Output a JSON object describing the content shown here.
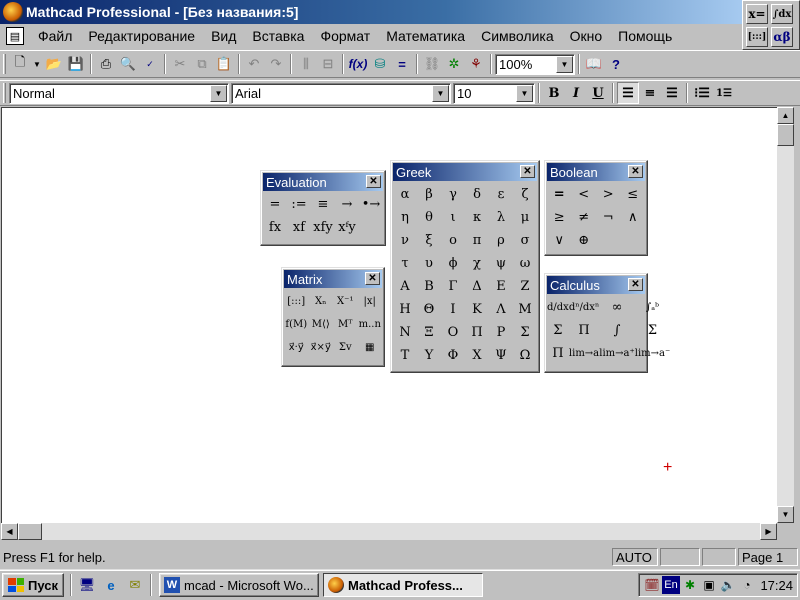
{
  "window": {
    "title": "Mathcad Professional - [Без названия:5]"
  },
  "math_palette": {
    "items": [
      "x=",
      "∫dx",
      "[:::]",
      "αβ"
    ]
  },
  "menu": {
    "items": [
      "Файл",
      "Редактирование",
      "Вид",
      "Вставка",
      "Формат",
      "Математика",
      "Символика",
      "Окно",
      "Помощь"
    ]
  },
  "toolbar": {
    "zoom": "100%"
  },
  "format_bar": {
    "style": "Normal",
    "font": "Arial",
    "size": "10",
    "bold": "B",
    "italic": "I",
    "underline": "U"
  },
  "palettes": {
    "evaluation": {
      "title": "Evaluation",
      "items": [
        "=",
        ":=",
        "≡",
        "→",
        "•→",
        "fx",
        "xf",
        "xfy",
        "xᶠy"
      ]
    },
    "matrix": {
      "title": "Matrix",
      "items": [
        "[:::]",
        "Xₙ",
        "X⁻¹",
        "|x|",
        "f(M)",
        "M⟨⟩",
        "Mᵀ",
        "m..n",
        "x⃗·y⃗",
        "x⃗×y⃗",
        "Σv",
        "▦"
      ]
    },
    "greek": {
      "title": "Greek",
      "items": [
        "α",
        "β",
        "γ",
        "δ",
        "ε",
        "ζ",
        "η",
        "θ",
        "ι",
        "κ",
        "λ",
        "μ",
        "ν",
        "ξ",
        "ο",
        "π",
        "ρ",
        "σ",
        "τ",
        "υ",
        "ϕ",
        "χ",
        "ψ",
        "ω",
        "Α",
        "Β",
        "Γ",
        "Δ",
        "Ε",
        "Ζ",
        "Η",
        "Θ",
        "Ι",
        "Κ",
        "Λ",
        "Μ",
        "Ν",
        "Ξ",
        "Ο",
        "Π",
        "Ρ",
        "Σ",
        "Τ",
        "Υ",
        "Φ",
        "Χ",
        "Ψ",
        "Ω"
      ]
    },
    "boolean": {
      "title": "Boolean",
      "items": [
        "=",
        "<",
        ">",
        "≤",
        "≥",
        "≠",
        "¬",
        "∧",
        "∨",
        "⊕"
      ]
    },
    "calculus": {
      "title": "Calculus",
      "items": [
        "d/dx",
        "dⁿ/dxⁿ",
        "∞",
        "∫ₐᵇ",
        "Σ",
        "Π",
        "∫",
        "Σ",
        "Π",
        "lim→a",
        "lim→a⁺",
        "lim→a⁻"
      ]
    }
  },
  "status": {
    "help": "Press F1 for help.",
    "mode": "AUTO",
    "page": "Page 1"
  },
  "taskbar": {
    "start": "Пуск",
    "tasks": [
      {
        "label": "mcad - Microsoft Wo...",
        "icon": "word-icon"
      },
      {
        "label": "Mathcad Profess...",
        "icon": "mathcad-icon"
      }
    ],
    "lang": "En",
    "clock": "17:24"
  }
}
